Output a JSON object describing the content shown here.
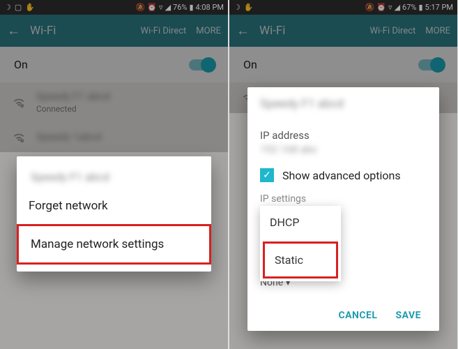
{
  "left": {
    "status": {
      "battery": "76%",
      "time": "4:08 PM"
    },
    "appbar": {
      "title": "Wi-Fi",
      "wifi_direct": "Wi-Fi Direct",
      "more": "MORE"
    },
    "on_label": "On",
    "networks": {
      "row1_sub": "Connected"
    },
    "dialog": {
      "forget": "Forget network",
      "manage": "Manage network settings"
    }
  },
  "right": {
    "status": {
      "battery": "67%",
      "time": "5:17 PM"
    },
    "appbar": {
      "title": "Wi-Fi",
      "wifi_direct": "Wi-Fi Direct",
      "more": "MORE"
    },
    "on_label": "On",
    "dialog": {
      "ip_address_label": "IP address",
      "show_advanced": "Show advanced options",
      "ip_settings_label": "IP settings",
      "opt_dhcp": "DHCP",
      "opt_static": "Static",
      "hidden_line": "None ▾",
      "cancel": "CANCEL",
      "save": "SAVE"
    }
  }
}
